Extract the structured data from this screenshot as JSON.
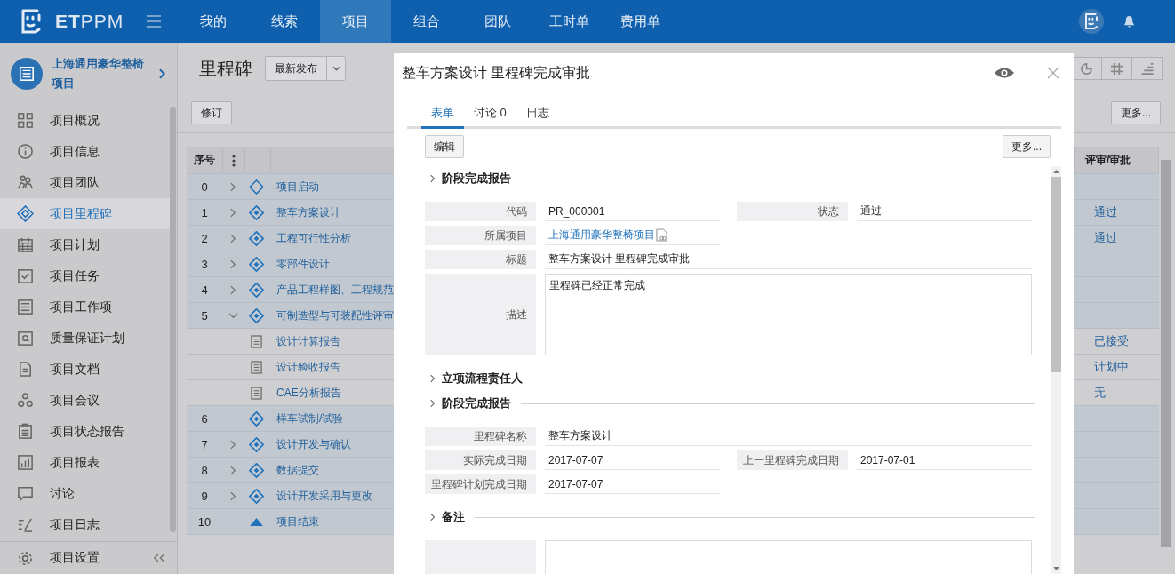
{
  "topbar": {
    "brand": "**ET**PPM",
    "nav": [
      {
        "label": "我的",
        "selected": false
      },
      {
        "label": "线索",
        "selected": false
      },
      {
        "label": "项目",
        "selected": true
      },
      {
        "label": "组合",
        "selected": false
      },
      {
        "label": "团队",
        "selected": false
      },
      {
        "label": "工时单",
        "selected": false
      },
      {
        "label": "费用单",
        "selected": false
      }
    ]
  },
  "sidebar": {
    "project": "上海通用豪华整椅项目",
    "items": [
      {
        "label": "项目概况",
        "selected": false
      },
      {
        "label": "项目信息",
        "selected": false
      },
      {
        "label": "项目团队",
        "selected": false
      },
      {
        "label": "项目里程碑",
        "selected": true
      },
      {
        "label": "项目计划",
        "selected": false
      },
      {
        "label": "项目任务",
        "selected": false
      },
      {
        "label": "项目工作项",
        "selected": false
      },
      {
        "label": "质量保证计划",
        "selected": false
      },
      {
        "label": "项目文档",
        "selected": false
      },
      {
        "label": "项目会议",
        "selected": false
      },
      {
        "label": "项目状态报告",
        "selected": false
      },
      {
        "label": "项目报表",
        "selected": false
      },
      {
        "label": "讨论",
        "selected": false
      },
      {
        "label": "项目日志",
        "selected": false
      }
    ],
    "footer": "项目设置"
  },
  "page": {
    "title": "里程碑",
    "version": "最新发布",
    "revise_button": "修订",
    "more_button": "更多...",
    "table": {
      "columns": [
        "序号",
        "评审/审批"
      ],
      "rows": [
        {
          "number": "0",
          "name": "项目启动",
          "kind": "start",
          "expandable": true,
          "expanded": false
        },
        {
          "number": "1",
          "name": "整车方案设计",
          "kind": "milestone",
          "expandable": true,
          "expanded": false,
          "review": "通过"
        },
        {
          "number": "2",
          "name": "工程可行性分析",
          "kind": "milestone",
          "expandable": true,
          "expanded": false,
          "review": "通过"
        },
        {
          "number": "3",
          "name": "零部件设计",
          "kind": "milestone",
          "expandable": true,
          "expanded": false
        },
        {
          "number": "4",
          "name": "产品工程样图、工程规范",
          "kind": "milestone",
          "expandable": true,
          "expanded": false
        },
        {
          "number": "5",
          "name": "可制造型与可装配性评审",
          "kind": "milestone",
          "expandable": true,
          "expanded": true,
          "children": [
            {
              "name": "设计计算报告",
              "kind": "document",
              "review": "已接受"
            },
            {
              "name": "设计验收报告",
              "kind": "document",
              "review": "计划中"
            },
            {
              "name": "CAE分析报告",
              "kind": "document",
              "review": "无"
            }
          ]
        },
        {
          "number": "6",
          "name": "样车试制/试验",
          "kind": "milestone",
          "expandable": false,
          "expanded": false
        },
        {
          "number": "7",
          "name": "设计开发与确认",
          "kind": "milestone",
          "expandable": true,
          "expanded": false
        },
        {
          "number": "8",
          "name": "数据提交",
          "kind": "milestone",
          "expandable": true,
          "expanded": false
        },
        {
          "number": "9",
          "name": "设计开发采用与更改",
          "kind": "milestone",
          "expandable": true,
          "expanded": false
        },
        {
          "number": "10",
          "name": "项目结束",
          "kind": "end",
          "expandable": false,
          "expanded": false
        }
      ]
    }
  },
  "dialog": {
    "title": "整车方案设计 里程碑完成审批",
    "tabs": [
      {
        "label": "表单",
        "selected": true
      },
      {
        "label": "讨论 0",
        "selected": false
      },
      {
        "label": "日志",
        "selected": false
      }
    ],
    "edit_button": "编辑",
    "more_button": "更多...",
    "sections": [
      {
        "title": "阶段完成报告",
        "rows": [
          [
            {
              "label": "代码",
              "value": "PR_000001",
              "kind": "text",
              "wide": false
            },
            {
              "label": "状态",
              "value": "通过",
              "kind": "text",
              "wide": false
            }
          ],
          [
            {
              "label": "所属项目",
              "value": "上海通用豪华整椅项目",
              "kind": "link",
              "wide": false
            }
          ],
          [
            {
              "label": "标题",
              "value": "整车方案设计 里程碑完成审批",
              "kind": "text",
              "wide": true
            }
          ],
          [
            {
              "label": "描述",
              "value": "里程碑已经正常完成",
              "kind": "textarea",
              "wide": true
            }
          ]
        ]
      },
      {
        "title": "立项流程责任人"
      },
      {
        "title": "阶段完成报告",
        "rows": [
          [
            {
              "label": "里程碑名称",
              "value": "整车方案设计",
              "kind": "text",
              "wide": true
            }
          ],
          [
            {
              "label": "实际完成日期",
              "value": "2017-07-07",
              "kind": "text",
              "wide": false
            },
            {
              "label": "上一里程碑完成日期",
              "value": "2017-07-01",
              "kind": "text",
              "wide": false
            }
          ],
          [
            {
              "label": "里程碑计划完成日期",
              "value": "2017-07-07",
              "kind": "text",
              "wide": false
            }
          ]
        ]
      },
      {
        "title": "备注",
        "rows": [
          [
            {
              "kind": "textarea",
              "wide": true
            }
          ]
        ]
      }
    ]
  }
}
